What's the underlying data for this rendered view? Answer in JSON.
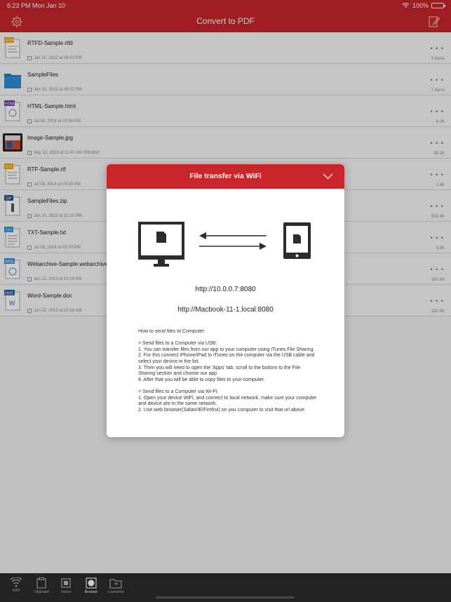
{
  "status_bar": {
    "time": "6:23 PM",
    "date": "Mon Jan 10",
    "battery": "100%"
  },
  "nav": {
    "title": "Convert to PDF",
    "settings_icon": "gear-icon",
    "edit_icon": "edit-document-icon"
  },
  "files": [
    {
      "name": "RTFD-Sample.rtfd",
      "date": "Jan 10, 2022 at 06:22 PM",
      "size": "3 items",
      "type": "RTFD",
      "icon": "rtfd-file-icon"
    },
    {
      "name": "SampleFiles",
      "date": "Jan 10, 2022 at 06:22 PM",
      "size": "7 items",
      "type": "folder",
      "icon": "folder-icon"
    },
    {
      "name": "HTML-Sample.html",
      "date": "Jul 08, 2014 at 03:34 PM",
      "size": "4.0K",
      "type": "HTML",
      "icon": "html-file-icon"
    },
    {
      "name": "Image-Sample.jpg",
      "date": "Sep 23, 2013 at 11:47 AM  398x652",
      "size": "88.1K",
      "type": "image",
      "icon": "image-file-icon"
    },
    {
      "name": "RTF-Sample.rtf",
      "date": "Jul 08, 2014 at 03:34 PM",
      "size": "2.4K",
      "type": "RTF",
      "icon": "rtf-file-icon"
    },
    {
      "name": "SampleFiles.zip",
      "date": "Jan 10, 2022 at 12:10 PM",
      "size": "550.6K",
      "type": "ZIP",
      "icon": "zip-file-icon"
    },
    {
      "name": "TXT-Sample.txt",
      "date": "Jul 08, 2014 at 03:33 PM",
      "size": "3.3K",
      "type": "TXT",
      "icon": "txt-file-icon"
    },
    {
      "name": "Webarchive-Sample.webarchive",
      "date": "Jun 22, 2013 at 02:19 AM",
      "size": "167.6K",
      "type": "WEB",
      "icon": "webarchive-file-icon"
    },
    {
      "name": "Word-Sample.doc",
      "date": "Jun 22, 2013 at 02:18 AM",
      "size": "182.5K",
      "type": "DOC",
      "icon": "doc-file-icon"
    }
  ],
  "more_label": "• • •",
  "modal": {
    "title": "File transfer via WiFi",
    "close_icon": "chevron-down-icon",
    "url_ip": "http://10.0.0.7:8080",
    "url_host": "http://Macbook-11-1.local:8080",
    "instructions": "How to send files to Computer:\n\n> Send files to a Computer via USB:\n1. You can transfer files from our app to your computer using iTunes File Sharing.\n2. For this connect iPhone/iPad to iTunes on the computer via the USB cable and select your device in the list.\n3. Then you will need to open the 'Apps' tab, scroll to the bottom to the File Sharing section and choose our app.\n4. After that you will be able to copy files to your computer.\n\n> Send files to a Computer via Wi-Fi:\n1. Open your device WiFi, and connect to local network, make sure your computer and device are in the same network.\n2. Use web browser(Safari/IE/Firefox) on you computer to visit that url above."
  },
  "tabs": [
    {
      "label": "WiFi",
      "icon": "wifi-icon"
    },
    {
      "label": "Clipboard",
      "icon": "clipboard-icon"
    },
    {
      "label": "Import",
      "icon": "import-icon"
    },
    {
      "label": "Browser",
      "icon": "globe-icon",
      "active": true
    },
    {
      "label": "Converted",
      "icon": "folder-icon"
    }
  ],
  "colors": {
    "brand_red": "#c8262b",
    "tabbar": "#2c2c2c"
  }
}
